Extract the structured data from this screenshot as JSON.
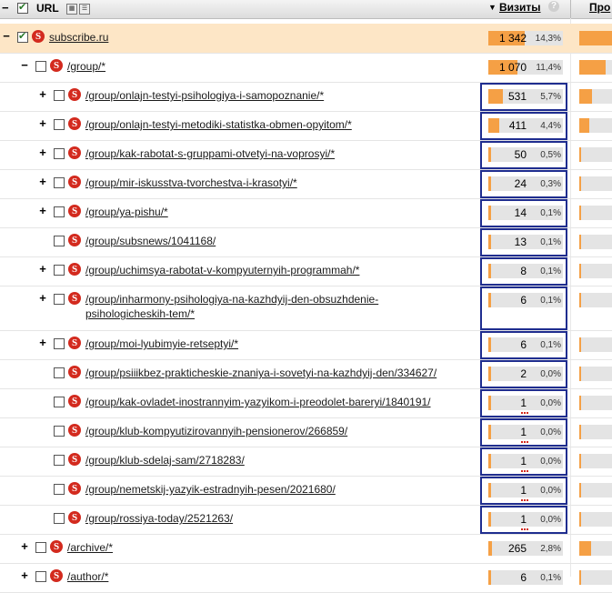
{
  "header": {
    "url_label": "URL",
    "visits_label": "Визиты",
    "help": "?",
    "next_col": "Про"
  },
  "colors": {
    "accent": "#f5a045",
    "highlight": "#fde6c6",
    "box": "#1f2d8f",
    "brand": "#d32a1e"
  },
  "rows": [
    {
      "indent": 0,
      "toggle": "−",
      "checked": true,
      "text": "subscribe.ru",
      "value": "1 342",
      "pct": "14,3%",
      "fill": 1.0,
      "boxed": false,
      "root": true,
      "next_fill": 1.0
    },
    {
      "indent": 1,
      "toggle": "−",
      "checked": false,
      "text": "/group/*",
      "value": "1 070",
      "pct": "11,4%",
      "fill": 0.8,
      "boxed": false,
      "next_fill": 0.8
    },
    {
      "indent": 2,
      "toggle": "+",
      "checked": false,
      "text": "/group/onlajn-testyi-psihologiya-i-samopoznanie/*",
      "value": "531",
      "pct": "5,7%",
      "fill": 0.4,
      "boxed": true,
      "next_fill": 0.4
    },
    {
      "indent": 2,
      "toggle": "+",
      "checked": false,
      "text": "/group/onlajn-testyi-metodiki-statistka-obmen-opyitom/*",
      "value": "411",
      "pct": "4,4%",
      "fill": 0.31,
      "boxed": true,
      "next_fill": 0.3
    },
    {
      "indent": 2,
      "toggle": "+",
      "checked": false,
      "text": "/group/kak-rabotat-s-gruppami-otvetyi-na-voprosyi/*",
      "value": "50",
      "pct": "0,5%",
      "fill": 0.04,
      "boxed": true,
      "next_fill": 0.04
    },
    {
      "indent": 2,
      "toggle": "+",
      "checked": false,
      "text": "/group/mir-iskusstva-tvorchestva-i-krasotyi/*",
      "value": "24",
      "pct": "0,3%",
      "fill": 0.02,
      "boxed": true,
      "next_fill": 0.02
    },
    {
      "indent": 2,
      "toggle": "+",
      "checked": false,
      "text": "/group/ya-pishu/*",
      "value": "14",
      "pct": "0,1%",
      "fill": 0.01,
      "boxed": true,
      "next_fill": 0.01
    },
    {
      "indent": 2,
      "toggle": "",
      "checked": false,
      "text": "/group/subsnews/1041168/",
      "value": "13",
      "pct": "0,1%",
      "fill": 0.01,
      "boxed": true,
      "next_fill": 0.01
    },
    {
      "indent": 2,
      "toggle": "+",
      "checked": false,
      "text": "/group/uchimsya-rabotat-v-kompyuternyih-programmah/*",
      "value": "8",
      "pct": "0,1%",
      "fill": 0.01,
      "boxed": true,
      "next_fill": 0.01
    },
    {
      "indent": 2,
      "toggle": "+",
      "checked": false,
      "text": "/group/inharmony-psihologiya-na-kazhdyij-den-obsuzhdenie-psihologicheskih-tem/*",
      "value": "6",
      "pct": "0,1%",
      "fill": 0.01,
      "boxed": true,
      "next_fill": 0.01,
      "tall": true
    },
    {
      "indent": 2,
      "toggle": "+",
      "checked": false,
      "text": "/group/moi-lyubimyie-retseptyi/*",
      "value": "6",
      "pct": "0,1%",
      "fill": 0.01,
      "boxed": true,
      "next_fill": 0.01
    },
    {
      "indent": 2,
      "toggle": "",
      "checked": false,
      "text": "/group/psiiikbez-prakticheskie-znaniya-i-sovetyi-na-kazhdyij-den/334627/",
      "value": "2",
      "pct": "0,0%",
      "fill": 0.01,
      "boxed": true,
      "next_fill": 0.01
    },
    {
      "indent": 2,
      "toggle": "",
      "checked": false,
      "text": "/group/kak-ovladet-inostrannyim-yazyikom-i-preodolet-bareryi/1840191/",
      "value": "1",
      "pct": "0,0%",
      "fill": 0.01,
      "boxed": true,
      "next_fill": 0.01,
      "dots": true
    },
    {
      "indent": 2,
      "toggle": "",
      "checked": false,
      "text": "/group/klub-kompyutizirovannyih-pensionerov/266859/",
      "value": "1",
      "pct": "0,0%",
      "fill": 0.01,
      "boxed": true,
      "next_fill": 0.01,
      "dots": true
    },
    {
      "indent": 2,
      "toggle": "",
      "checked": false,
      "text": "/group/klub-sdelaj-sam/2718283/",
      "value": "1",
      "pct": "0,0%",
      "fill": 0.01,
      "boxed": true,
      "next_fill": 0.01,
      "dots": true
    },
    {
      "indent": 2,
      "toggle": "",
      "checked": false,
      "text": "/group/nemetskij-yazyik-estradnyih-pesen/2021680/",
      "value": "1",
      "pct": "0,0%",
      "fill": 0.01,
      "boxed": true,
      "next_fill": 0.01,
      "dots": true
    },
    {
      "indent": 2,
      "toggle": "",
      "checked": false,
      "text": "/group/rossiya-today/2521263/",
      "value": "1",
      "pct": "0,0%",
      "fill": 0.01,
      "boxed": true,
      "next_fill": 0.01,
      "dots": true
    },
    {
      "indent": 1,
      "toggle": "+",
      "checked": false,
      "text": "/archive/*",
      "value": "265",
      "pct": "2,8%",
      "fill": 0.1,
      "boxed": false,
      "next_fill": 0.35
    },
    {
      "indent": 1,
      "toggle": "+",
      "checked": false,
      "text": "/author/*",
      "value": "6",
      "pct": "0,1%",
      "fill": 0.01,
      "boxed": false,
      "next_fill": 0.01
    }
  ]
}
